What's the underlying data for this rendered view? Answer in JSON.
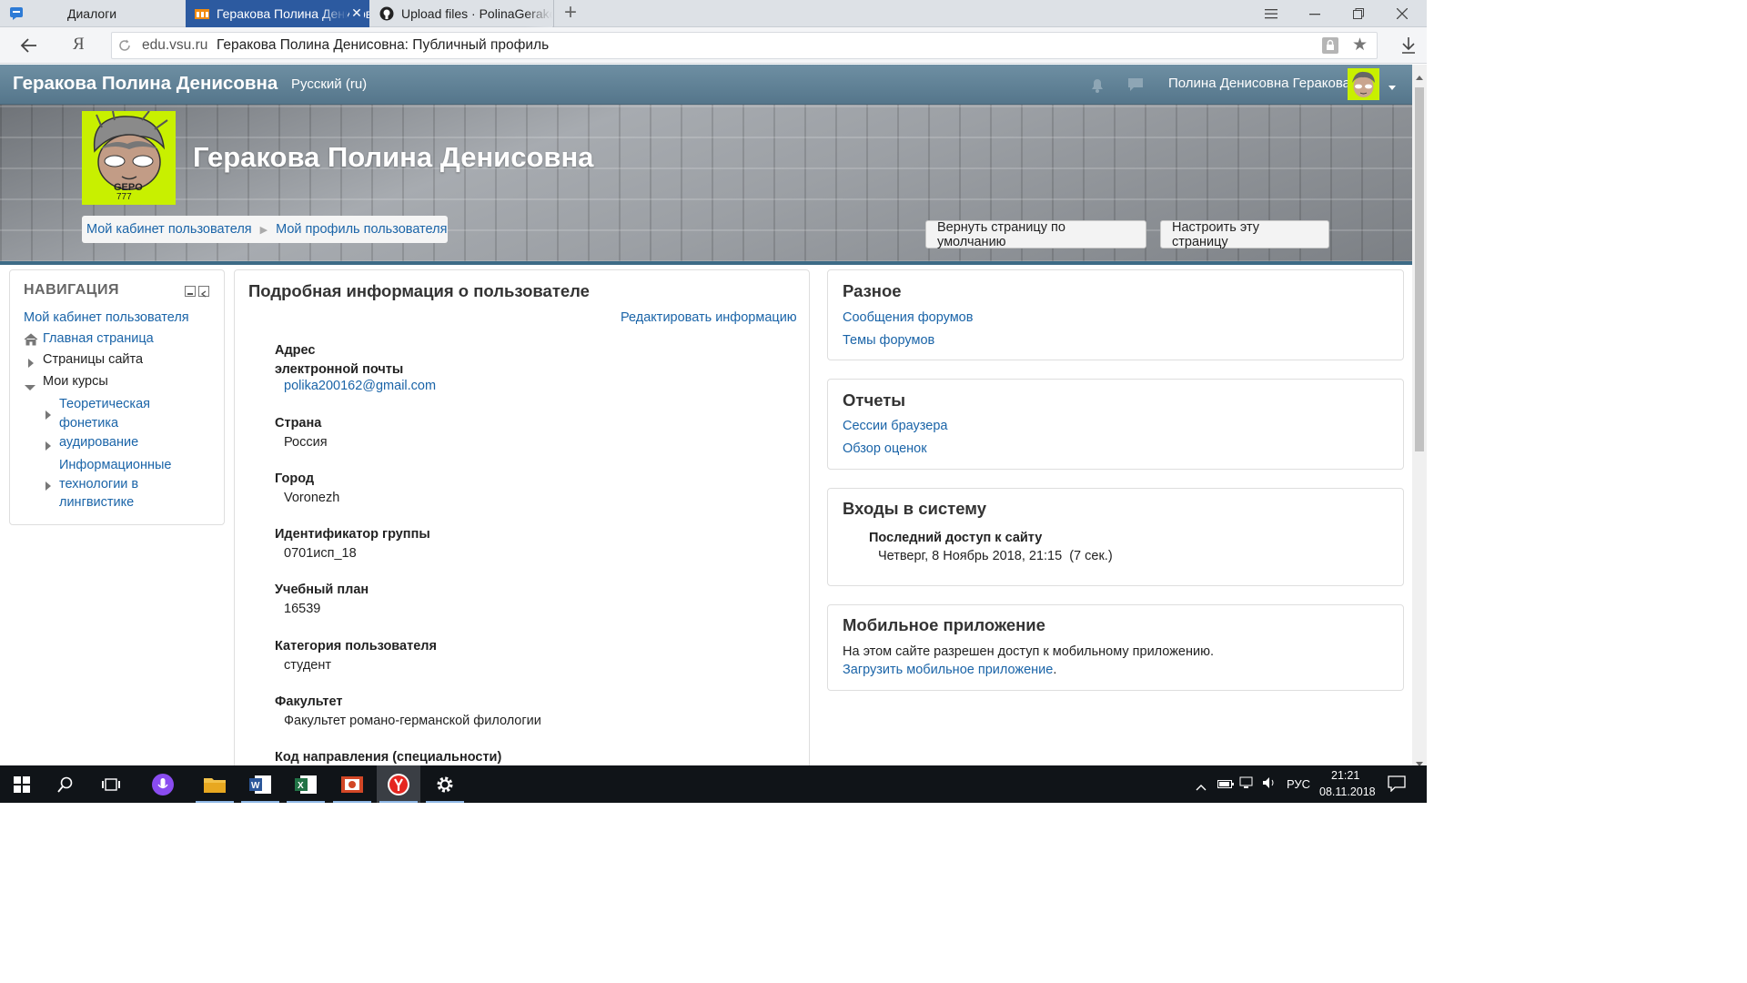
{
  "browser": {
    "tabs": [
      {
        "label": "Диалоги",
        "active": false
      },
      {
        "label": "Геракова Полина Денисовна",
        "active": true
      },
      {
        "label": "Upload files · PolinaGerakova",
        "active": false
      }
    ],
    "new_tab_symbol": "+",
    "window_controls": [
      "menu-icon",
      "minimize-icon",
      "restore-icon",
      "close-icon"
    ],
    "address": {
      "domain": "edu.vsu.ru",
      "page_title": "Геракова Полина Денисовна: Публичный профиль"
    },
    "yandex_glyph": "Я"
  },
  "navbar": {
    "site_name": "Геракова Полина Денисовна",
    "language": "Русский (ru)",
    "user_name": "Полина Денисовна Геракова"
  },
  "header": {
    "title": "Геракова Полина Денисовна",
    "avatar_text": "GEPO",
    "avatar_subtext": "777",
    "breadcrumb": [
      "Мой кабинет пользователя",
      "Мой профиль пользователя"
    ],
    "reset_button": "Вернуть страницу по умолчанию",
    "customize_button": "Настроить эту страницу"
  },
  "navigation": {
    "title": "НАВИГАЦИЯ",
    "dashboard": "Мой кабинет пользователя",
    "home": "Главная страница",
    "site_pages": "Страницы сайта",
    "my_courses": "Мои курсы",
    "courses": [
      {
        "lines": [
          "Теоретическая",
          "фонетика"
        ]
      },
      {
        "lines": [
          "аудирование"
        ]
      },
      {
        "lines": [
          "Информационные",
          "технологии в",
          "лингвистике"
        ]
      }
    ]
  },
  "details": {
    "title": "Подробная информация о пользователе",
    "edit_link": "Редактировать информацию",
    "fields": [
      {
        "label_lines": [
          "Адрес",
          "электронной почты"
        ],
        "value": "polika200162@gmail.com",
        "is_link": true
      },
      {
        "label_lines": [
          "Страна"
        ],
        "value": "Россия",
        "is_link": false
      },
      {
        "label_lines": [
          "Город"
        ],
        "value": "Voronezh",
        "is_link": false
      },
      {
        "label_lines": [
          "Идентификатор группы"
        ],
        "value": "0701исп_18",
        "is_link": false
      },
      {
        "label_lines": [
          "Учебный план"
        ],
        "value": "16539",
        "is_link": false
      },
      {
        "label_lines": [
          "Категория пользователя"
        ],
        "value": "студент",
        "is_link": false
      },
      {
        "label_lines": [
          "Факультет"
        ],
        "value": "Факультет романо-германской филологии",
        "is_link": false
      },
      {
        "label_lines": [
          "Код направления (специальности)"
        ],
        "value": "",
        "is_link": false
      }
    ]
  },
  "misc": {
    "title": "Разное",
    "links": [
      "Сообщения форумов",
      "Темы форумов"
    ]
  },
  "reports": {
    "title": "Отчеты",
    "links": [
      "Сессии браузера",
      "Обзор оценок"
    ]
  },
  "logins": {
    "title": "Входы в систему",
    "label": "Последний доступ к сайту",
    "value": "Четверг, 8 Ноябрь 2018, 21:15  (7 сек.)"
  },
  "mobile": {
    "title": "Мобильное приложение",
    "text": "На этом сайте разрешен доступ к мобильному приложению.",
    "link": "Загрузить мобильное приложение",
    "link_suffix": "."
  },
  "taskbar": {
    "language": "РУС",
    "time": "21:21",
    "date": "08.11.2018"
  },
  "colors": {
    "link": "#1a64a8",
    "navbar": "#5f8196",
    "avatar_bg": "#c8f000",
    "active_tab": "#2c5aa0"
  }
}
